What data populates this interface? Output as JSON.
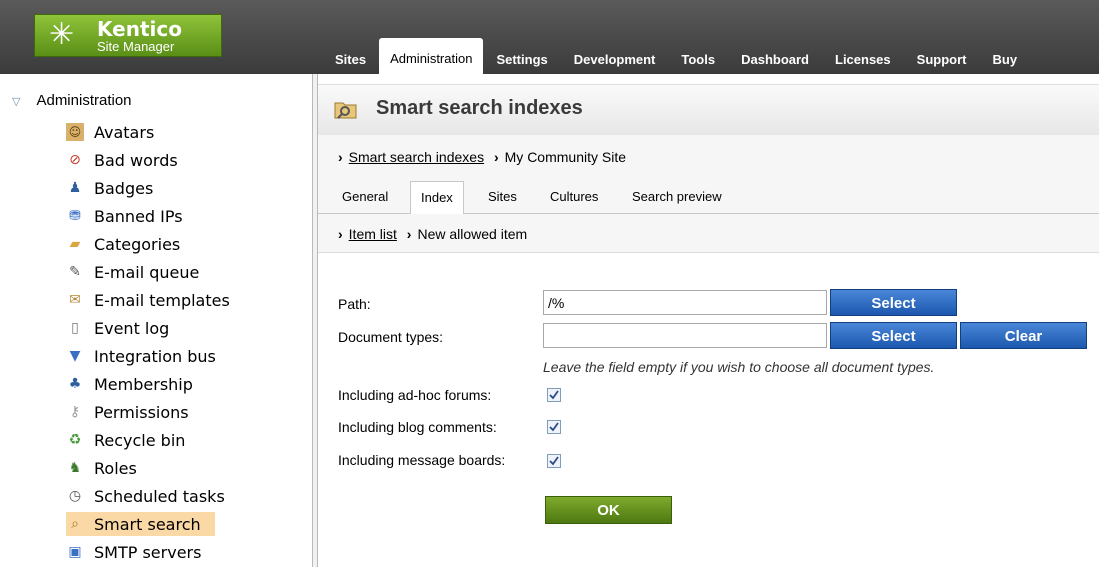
{
  "header": {
    "logo_title": "Kentico",
    "logo_subtitle": "Site Manager",
    "tabs": [
      "Sites",
      "Administration",
      "Settings",
      "Development",
      "Tools",
      "Dashboard",
      "Licenses",
      "Support",
      "Buy"
    ],
    "active_tab": "Administration"
  },
  "sidebar": {
    "root": "Administration",
    "items": [
      {
        "label": "Avatars",
        "icon": "avatar-icon"
      },
      {
        "label": "Bad words",
        "icon": "bad-words-icon"
      },
      {
        "label": "Badges",
        "icon": "badges-icon"
      },
      {
        "label": "Banned IPs",
        "icon": "banned-ips-icon"
      },
      {
        "label": "Categories",
        "icon": "categories-icon"
      },
      {
        "label": "E-mail queue",
        "icon": "email-queue-icon"
      },
      {
        "label": "E-mail templates",
        "icon": "email-templates-icon"
      },
      {
        "label": "Event log",
        "icon": "event-log-icon"
      },
      {
        "label": "Integration bus",
        "icon": "integration-bus-icon"
      },
      {
        "label": "Membership",
        "icon": "membership-icon"
      },
      {
        "label": "Permissions",
        "icon": "permissions-icon"
      },
      {
        "label": "Recycle bin",
        "icon": "recycle-bin-icon"
      },
      {
        "label": "Roles",
        "icon": "roles-icon"
      },
      {
        "label": "Scheduled tasks",
        "icon": "scheduled-tasks-icon"
      },
      {
        "label": "Smart search",
        "icon": "smart-search-icon"
      },
      {
        "label": "SMTP servers",
        "icon": "smtp-servers-icon"
      }
    ],
    "selected": "Smart search"
  },
  "main": {
    "title": "Smart search indexes",
    "breadcrumb": {
      "link": "Smart search indexes",
      "current": "My Community Site"
    },
    "tabs": [
      "General",
      "Index",
      "Sites",
      "Cultures",
      "Search preview"
    ],
    "active_tab": "Index",
    "breadcrumb2": {
      "link": "Item list",
      "current": "New allowed item"
    },
    "form": {
      "path_label": "Path:",
      "path_value": "/%",
      "doc_types_label": "Document types:",
      "doc_types_value": "",
      "select_label": "Select",
      "clear_label": "Clear",
      "hint": "Leave the field empty if you wish to choose all document types.",
      "forums_label": "Including ad-hoc forums:",
      "forums_checked": true,
      "blog_label": "Including blog comments:",
      "blog_checked": true,
      "boards_label": "Including message boards:",
      "boards_checked": true,
      "ok_label": "OK"
    }
  }
}
